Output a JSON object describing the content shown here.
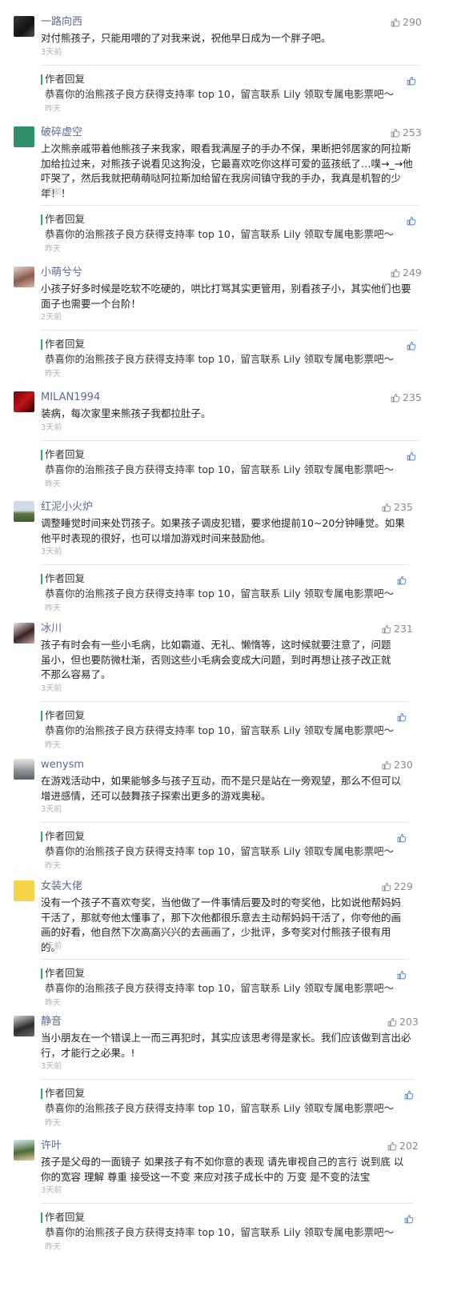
{
  "colors": {
    "name": "#576b95",
    "accent_green": "#2aae67",
    "like_gray": "#8a8a8a",
    "time_gray": "#b2b2b2"
  },
  "reply": {
    "label": "作者回复",
    "text": "恭喜你的治熊孩子良方获得支持率 top 10，留言联系 Lily 领取专属电影票吧～",
    "time": "昨天",
    "like_icon": "thumb-up-icon"
  },
  "comments": [
    {
      "name": "一路向西",
      "likes": "290",
      "text": "对付熊孩子，只能用喂的了对我来说，祝他早日成为一个胖子吧。",
      "time": "3天前",
      "avatar_icon": "avatar-dark-photo"
    },
    {
      "name": "破碎虚空",
      "likes": "253",
      "text": "上次熊亲戚带着他熊孩子来我家，眼看我满屋子的手办不保，果断把邻居家的阿拉斯加给拉过来，对熊孩子说看见这狗没，它最喜欢吃你这样可爱的蓝孩纸了…噗→_→他吓哭了，然后我就把萌萌哒阿拉斯加给留在我房间镇守我的手办，我真是机智的少年！！",
      "time": "2天前",
      "avatar_icon": "avatar-green-logo"
    },
    {
      "name": "小萌兮兮",
      "likes": "249",
      "text": "小孩子好多时候是吃软不吃硬的，哄比打骂其实更管用，别看孩子小，其实他们也要面子也需要一个台阶！",
      "time": "2天前",
      "avatar_icon": "avatar-girl-photo"
    },
    {
      "name": "MILAN1994",
      "likes": "235",
      "text": "装病，每次家里来熊孩子我都拉肚子。",
      "time": "3天前",
      "avatar_icon": "avatar-red-logo"
    },
    {
      "name": "红泥小火炉",
      "likes": "235",
      "text": "调整睡觉时间来处罚孩子。如果孩子调皮犯错，要求他提前10~20分钟睡觉。如果他平时表现的很好，也可以增加游戏时间来鼓励他。",
      "time": "3天前",
      "avatar_icon": "avatar-landscape-photo"
    },
    {
      "name": "冰川",
      "likes": "231",
      "text": "孩子有时会有一些小毛病，比如霸道、无礼、懒惰等，这时候就要注意了，问题虽小，但也要防微杜渐，否则这些小毛病会变成大问题，到时再想让孩子改正就不那么容易了。",
      "time": "3天前",
      "avatar_icon": "avatar-woman-photo"
    },
    {
      "name": "wenysm",
      "likes": "230",
      "text": "在游戏活动中，如果能够多与孩子互动，而不是只是站在一旁观望，那么不但可以增进感情，还可以鼓舞孩子探索出更多的游戏奥秘。",
      "time": "3天前",
      "avatar_icon": "avatar-gray-photo"
    },
    {
      "name": "女装大佬",
      "likes": "229",
      "text": "没有一个孩子不喜欢夸奖，当他做了一件事情后要及时的夸奖他，比如说他帮妈妈干活了，那就夸他太懂事了，那下次他都很乐意去主动帮妈妈干活了，你夸他的画画的好看，他自然下次高高兴兴的去画画了，少批评，多夸奖对付熊孩子很有用的。",
      "time": "2天前",
      "avatar_icon": "avatar-yellow-cartoon"
    },
    {
      "name": "静音",
      "likes": "203",
      "text": "当小朋友在一个错误上一而三再犯时，其实应该思考得是家长。我们应该做到言出必行，才能行之必果。!",
      "time": "3天前",
      "avatar_icon": "avatar-dark-figure"
    },
    {
      "name": "许叶",
      "likes": "202",
      "text": "孩子是父母的一面镜子 如果孩子有不如你意的表现 请先审视自己的言行 说到底 以你的宽容 理解 尊重 接受这一不变 来应对孩子成长中的 万变 是不变的法宝",
      "time": "3天前",
      "avatar_icon": "avatar-child-photo"
    }
  ]
}
